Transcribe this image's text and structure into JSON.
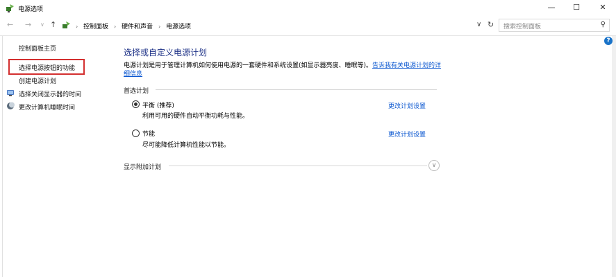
{
  "window": {
    "title": "电源选项",
    "minimize_glyph": "—",
    "maximize_glyph": "☐",
    "close_glyph": "✕"
  },
  "address": {
    "crumbs": [
      "控制面板",
      "硬件和声音",
      "电源选项"
    ],
    "search_placeholder": "搜索控制面板"
  },
  "sidebar": {
    "home": "控制面板主页",
    "items": [
      {
        "label": "选择电源按钮的功能",
        "icon": null
      },
      {
        "label": "创建电源计划",
        "icon": null
      },
      {
        "label": "选择关闭显示器的时间",
        "icon": "monitor-icon"
      },
      {
        "label": "更改计算机睡眠时间",
        "icon": "moon-icon"
      }
    ]
  },
  "main": {
    "title": "选择或自定义电源计划",
    "description": "电源计划是用于管理计算机如何使用电源的一套硬件和系统设置(如显示器亮度、睡眠等)。",
    "description_link": "告诉我有关电源计划的详细信息",
    "preferred_header": "首选计划",
    "plans": [
      {
        "name": "平衡 (推荐)",
        "desc": "利用可用的硬件自动平衡功耗与性能。",
        "link": "更改计划设置",
        "selected": true
      },
      {
        "name": "节能",
        "desc": "尽可能降低计算机性能以节能。",
        "link": "更改计划设置",
        "selected": false
      }
    ],
    "extra_header": "显示附加计划"
  },
  "colors": {
    "link": "#0b57d0",
    "title": "#1e3287",
    "highlight": "#d32f2f"
  }
}
